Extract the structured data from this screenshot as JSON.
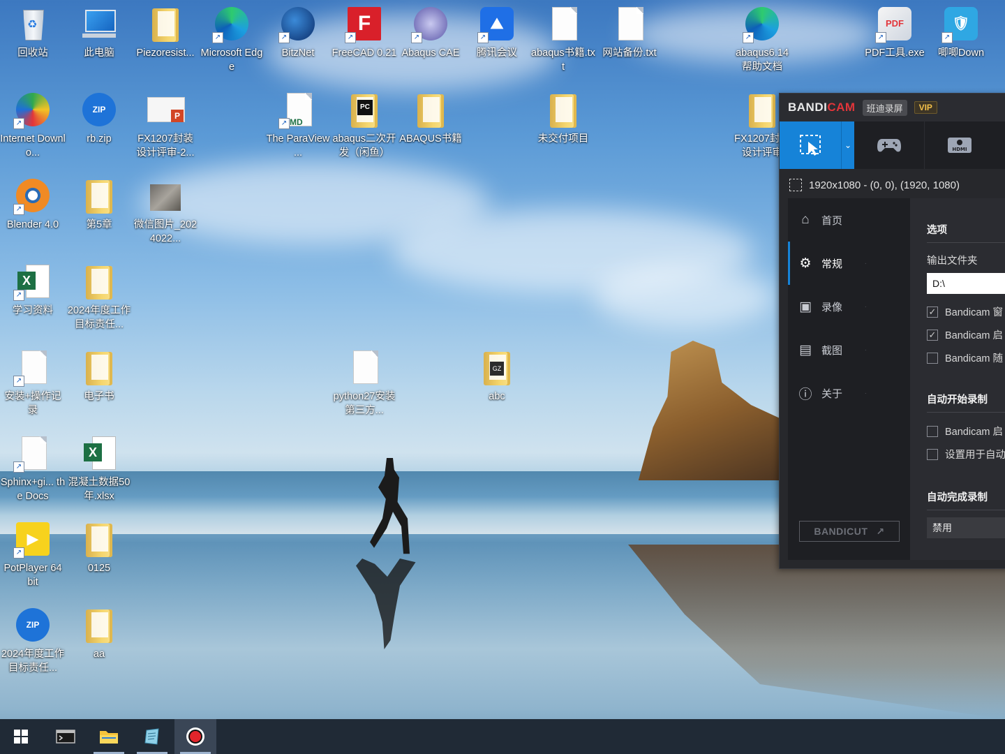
{
  "desktop": {
    "icons": [
      {
        "label": "回收站",
        "icon": "recycle-bin-icon"
      },
      {
        "label": "此电脑",
        "icon": "computer-icon"
      },
      {
        "label": "Piezoresist...",
        "icon": "folder-icon"
      },
      {
        "label": "Microsoft Edge",
        "icon": "edge-icon"
      },
      {
        "label": "BitzNet",
        "icon": "bitznet-icon"
      },
      {
        "label": "FreeCAD 0.21",
        "icon": "freecad-icon"
      },
      {
        "label": "Abaqus CAE",
        "icon": "abaqus-icon"
      },
      {
        "label": "腾讯会议",
        "icon": "tencent-meeting-icon"
      },
      {
        "label": "abaqus书籍.txt",
        "icon": "text-file-icon"
      },
      {
        "label": "网站备份.txt",
        "icon": "text-file-icon"
      },
      {
        "label": "abaqus6.14 帮助文档",
        "icon": "edge-icon"
      },
      {
        "label": "PDF工具.exe",
        "icon": "pdf-tool-icon"
      },
      {
        "label": "唧唧Down",
        "icon": "jijidown-icon"
      },
      {
        "label": "Internet Downlo...",
        "icon": "idm-icon"
      },
      {
        "label": "rb.zip",
        "icon": "zip-icon"
      },
      {
        "label": "FX1207封装设计评审-2...",
        "icon": "pptx-icon"
      },
      {
        "label": "The ParaView ...",
        "icon": "markdown-icon"
      },
      {
        "label": "abaqus二次开发（闲鱼）",
        "icon": "pycharm-icon"
      },
      {
        "label": "ABAQUS书籍",
        "icon": "folder-icon"
      },
      {
        "label": "未交付项目",
        "icon": "folder-icon"
      },
      {
        "label": "FX1207封装设计评审",
        "icon": "folder-icon"
      },
      {
        "label": "Blender 4.0",
        "icon": "blender-icon"
      },
      {
        "label": "第5章",
        "icon": "folder-icon"
      },
      {
        "label": "微信图片_2024022...",
        "icon": "image-icon"
      },
      {
        "label": "学习资料",
        "icon": "excel-icon"
      },
      {
        "label": "2024年度工作目标责任...",
        "icon": "folder-icon"
      },
      {
        "label": "安装+操作记录",
        "icon": "text-file-icon"
      },
      {
        "label": "电子书",
        "icon": "folder-icon"
      },
      {
        "label": "python27安装第三方...",
        "icon": "text-file-icon"
      },
      {
        "label": "abc",
        "icon": "zip-folder-icon"
      },
      {
        "label": "Sphinx+gi... the Docs",
        "icon": "text-file-icon"
      },
      {
        "label": "混凝土数据50年.xlsx",
        "icon": "excel-icon"
      },
      {
        "label": "PotPlayer 64 bit",
        "icon": "potplayer-icon"
      },
      {
        "label": "0125",
        "icon": "folder-icon"
      },
      {
        "label": "2024年度工作目标责任...",
        "icon": "zip-icon"
      },
      {
        "label": "aa",
        "icon": "folder-icon"
      }
    ]
  },
  "bandicam": {
    "brand_a": "BANDI",
    "brand_b": "CAM",
    "brand_cn": "班迪录屏",
    "vip": "VIP",
    "resolution": "1920x1080 - (0, 0), (1920, 1080)",
    "nav": [
      {
        "label": "首页",
        "icon": "home-icon"
      },
      {
        "label": "常规",
        "icon": "gear-icon"
      },
      {
        "label": "录像",
        "icon": "video-settings-icon"
      },
      {
        "label": "截图",
        "icon": "image-settings-icon"
      },
      {
        "label": "关于",
        "icon": "info-icon"
      }
    ],
    "bandicut": "BANDICUT",
    "options_title": "选项",
    "output_folder_label": "输出文件夹",
    "output_folder_value": "D:\\",
    "checks": [
      {
        "label": "Bandicam 窗",
        "checked": true
      },
      {
        "label": "Bandicam 启",
        "checked": true
      },
      {
        "label": "Bandicam 随",
        "checked": false
      }
    ],
    "auto_start_title": "自动开始录制",
    "auto_start_checks": [
      {
        "label": "Bandicam 启",
        "checked": false
      },
      {
        "label": "设置用于自动",
        "checked": false
      }
    ],
    "auto_finish_title": "自动完成录制",
    "auto_finish_value": "禁用"
  },
  "colors": {
    "bandicam_accent": "#1683d8",
    "bandicam_red": "#e2353a",
    "taskbar": "#202a36"
  },
  "taskbar": {
    "items": [
      "start-button",
      "terminal-app",
      "file-explorer-app",
      "notes-app",
      "bandicam-app"
    ]
  }
}
